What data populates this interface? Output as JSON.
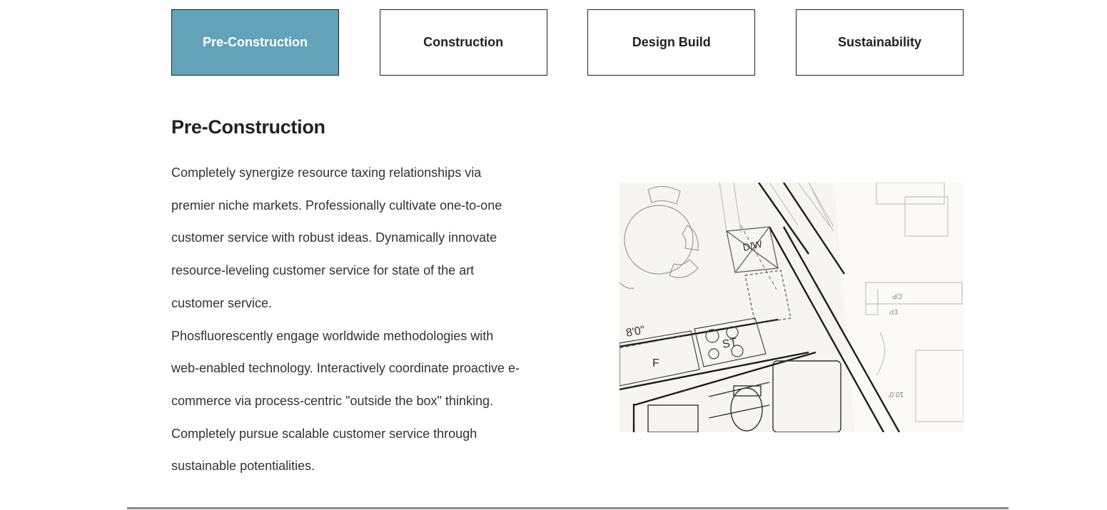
{
  "tabs": [
    {
      "label": "Pre-Construction",
      "active": true
    },
    {
      "label": "Construction",
      "active": false
    },
    {
      "label": "Design Build",
      "active": false
    },
    {
      "label": "Sustainability",
      "active": false
    }
  ],
  "section": {
    "title": "Pre-Construction",
    "paragraphs": [
      "Completely synergize resource taxing relationships via premier niche markets. Professionally cultivate one-to-one customer service with robust ideas. Dynamically innovate resource-leveling customer service for state of the art customer service.",
      "Phosfluorescently engage worldwide methodologies with web-enabled technology. Interactively coordinate proactive e-commerce via process-centric \"outside the box\" thinking. Completely pursue scalable customer service through sustainable potentialities."
    ]
  },
  "image": {
    "labels": {
      "dw": "D/W",
      "dimension": "8'0\"",
      "f": "F",
      "st": "ST",
      "cp": "CP",
      "ep": "EP",
      "ten": "10.0'"
    }
  },
  "colors": {
    "accent": "#62a3ba",
    "text": "#222222",
    "rule": "#8a8a8a"
  }
}
